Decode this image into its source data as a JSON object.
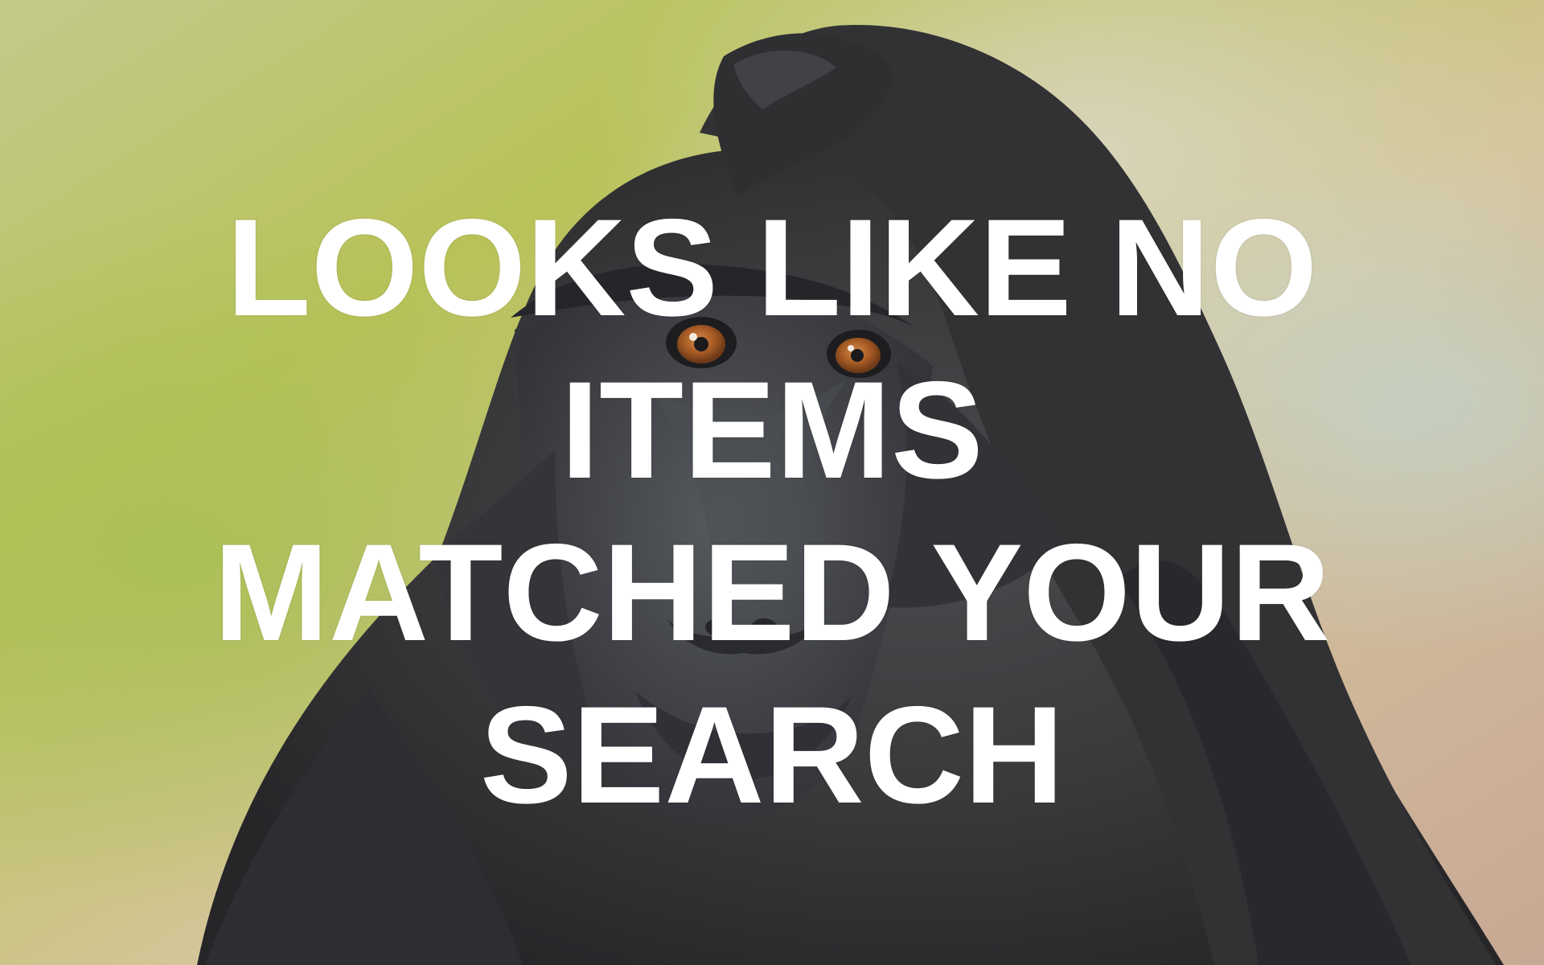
{
  "empty_state": {
    "lines": [
      "LOOKS LIKE NO",
      "ITEMS",
      "MATCHED YOUR",
      "SEARCH"
    ],
    "text_color": "#ffffff",
    "image": {
      "subject": "crested-black-macaque-thinking",
      "background_colors": [
        "#b7c25a",
        "#d9c89c",
        "#b9cdb6",
        "#c9aa93"
      ],
      "fur_color": "#3d3d3f",
      "eye_color": "#9b4b1f"
    }
  }
}
